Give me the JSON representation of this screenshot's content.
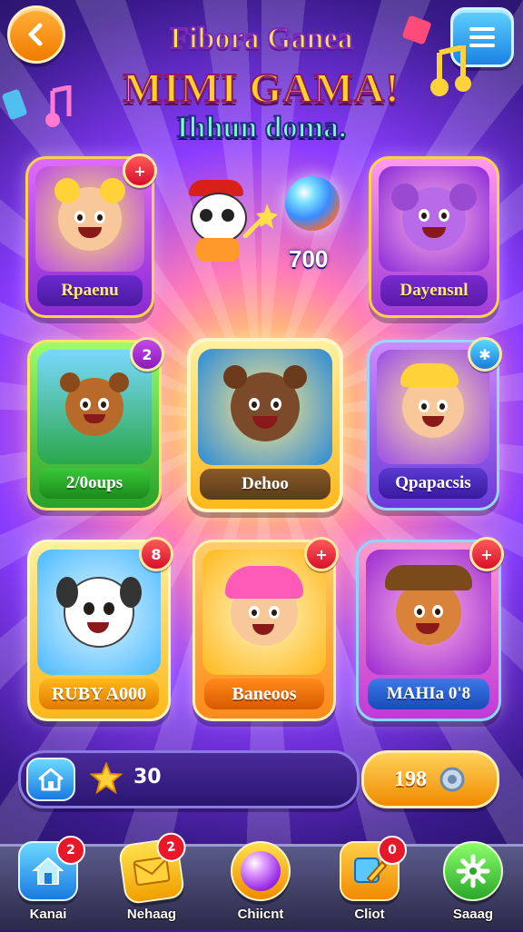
{
  "header": {
    "title_line1": "Fibora Ganea",
    "title_line2": "MIMI GAMA!",
    "title_line3": "Ihhun doma."
  },
  "featured": {
    "score": "700"
  },
  "cards": [
    {
      "label": "Rpaenu",
      "badge": "+"
    },
    {
      "label": "Dayensnl",
      "badge": ""
    },
    {
      "label": "2/0oups",
      "badge": "2"
    },
    {
      "label": "Dehoo",
      "badge": ""
    },
    {
      "label": "Qpapacsis",
      "badge": "✱"
    },
    {
      "label": "RUBY A000",
      "badge": "8"
    },
    {
      "label": "Baneoos",
      "badge": "+"
    },
    {
      "label": "MAHIa 0'8",
      "badge": "+"
    }
  ],
  "currency": {
    "stars": "30",
    "coins": "198"
  },
  "nav": [
    {
      "label": "Kanai",
      "badge": "2"
    },
    {
      "label": "Nehaag",
      "badge": "2"
    },
    {
      "label": "Chiicnt",
      "badge": ""
    },
    {
      "label": "Cliot",
      "badge": "0"
    },
    {
      "label": "Saaag",
      "badge": ""
    }
  ],
  "colors": {
    "accent": "#ffd22a",
    "card_purple": "#b04ae8",
    "card_green": "#3ac83a",
    "card_gold": "#ffb81a",
    "card_orange": "#ff8a1a",
    "nav_bg": "#3a3a6a"
  }
}
